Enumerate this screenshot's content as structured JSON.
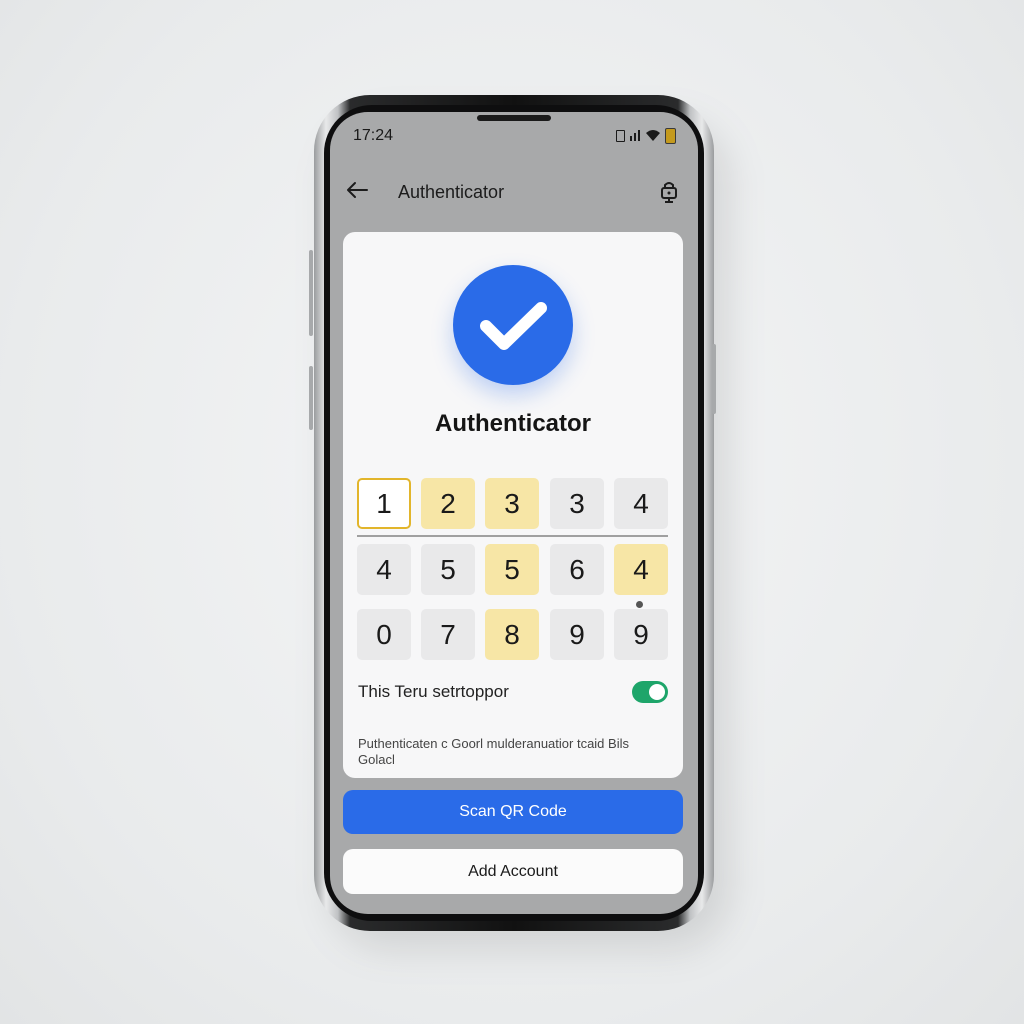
{
  "status_bar": {
    "time": "17:24",
    "icons": [
      "sim-icon",
      "signal-icon",
      "wifi-icon",
      "battery-icon"
    ]
  },
  "app_bar": {
    "title": "Authenticator",
    "back_icon": "arrow-left-icon",
    "action_icon": "account-lock-icon"
  },
  "card": {
    "status_icon": "checkmark-icon",
    "title": "Authenticator",
    "keypad": {
      "row1": [
        "1",
        "2",
        "3",
        "3",
        "4"
      ],
      "row2": [
        "4",
        "5",
        "5",
        "6",
        "4"
      ],
      "row3": [
        "0",
        "7",
        "8",
        "9",
        "9"
      ]
    },
    "toggle": {
      "label": "This Teru setrtoppor",
      "on": true
    },
    "description": "Puthenticaten c Goorl mulderanuatior tcaid Bils Golacl"
  },
  "buttons": {
    "scan": "Scan QR Code",
    "add": "Add Account"
  },
  "colors": {
    "accent": "#2a6be8",
    "highlight": "#f7e6a6",
    "selected_border": "#e2b52b",
    "toggle_on": "#1ea56a"
  }
}
